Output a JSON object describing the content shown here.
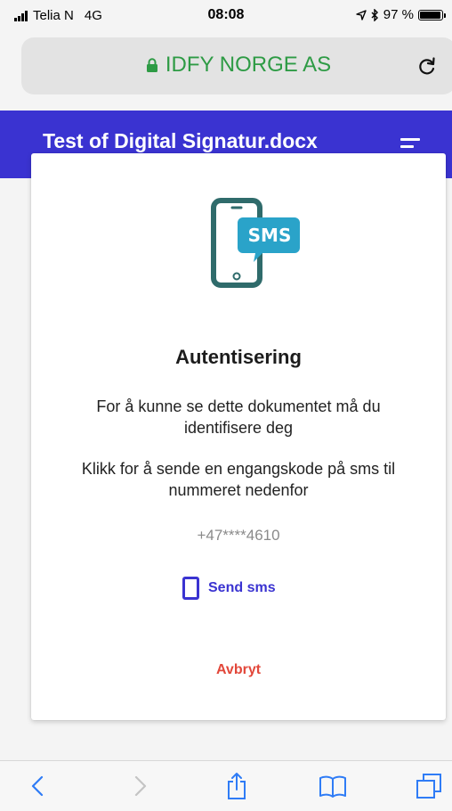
{
  "status_bar": {
    "carrier": "Telia N",
    "network": "4G",
    "time": "08:08",
    "battery": "97 %",
    "battery_level": 0.97
  },
  "url_bar": {
    "domain": "IDFY NORGE AS",
    "lock_icon": "lock-icon",
    "reload_icon": "reload-icon",
    "accent": "#2e9b45"
  },
  "app_bar": {
    "title": "Test of Digital Signatur.docx",
    "menu_icon": "menu-icon",
    "color": "#3a33d1"
  },
  "modal": {
    "icon_label": "SMS",
    "title": "Autentisering",
    "message_1": "For å kunne se dette dokumentet må du identifisere deg",
    "message_2": "Klikk for å sende en engangskode på sms til nummeret nedenfor",
    "phone_number": "+47****4610",
    "send_label": "Send sms",
    "cancel_label": "Avbryt",
    "cancel_color": "#e2473a"
  },
  "toolbar": {
    "items": [
      "back-icon",
      "forward-icon",
      "share-icon",
      "bookmarks-icon",
      "tabs-icon"
    ]
  }
}
